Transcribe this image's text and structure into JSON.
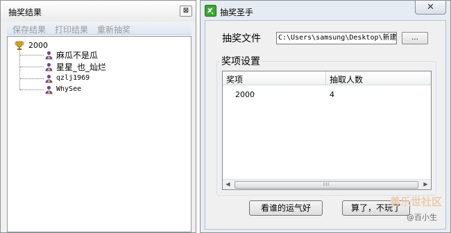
{
  "left_window": {
    "title": "抽奖结果",
    "close_glyph": "⊠",
    "toolbar": [
      "保存结果",
      "打印结果",
      "重新抽奖"
    ],
    "tree": {
      "root_label": "2000",
      "root_icon": "trophy-icon",
      "children": [
        {
          "label": "麻瓜不是瓜",
          "icon": "person-icon"
        },
        {
          "label": "星星_也_灿烂",
          "icon": "person-icon"
        },
        {
          "label": "qzlj1969",
          "icon": "person-icon"
        },
        {
          "label": "WhySee",
          "icon": "person-icon"
        }
      ]
    }
  },
  "right_window": {
    "title": "抽奖圣手",
    "app_icon": "lottery-app-icon",
    "close_glyph": "✕",
    "file_label": "抽奖文件",
    "file_path": "C:\\Users\\samsung\\Desktop\\新建",
    "browse_label": "...",
    "group_title": "奖项设置",
    "columns": [
      "奖项",
      "抽取人数"
    ],
    "rows": [
      [
        "2000",
        "4"
      ]
    ],
    "scrollbar_grip": "III",
    "buttons": {
      "lucky": "看谁的运气好",
      "quit": "算了，不玩了"
    }
  },
  "watermark": {
    "line1": "善乐世社区",
    "line2": "@百小生"
  },
  "colors": {
    "toolbar_disabled_text": "#9a9a9a",
    "trophy_gold": "#d9a400",
    "person_purple": "#6b4a8e",
    "app_icon_green": "#3aa82e"
  }
}
